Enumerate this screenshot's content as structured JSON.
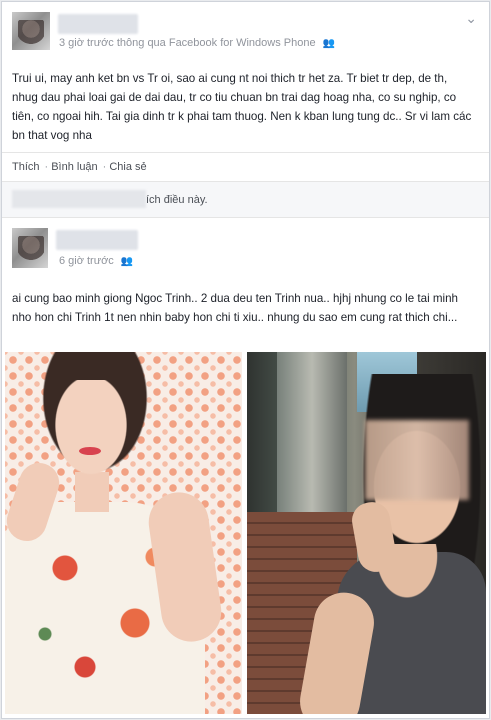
{
  "post1": {
    "meta": "3 giờ trước thông qua Facebook for Windows Phone",
    "friends_icon": "friends-icon",
    "text": "Trui ui, may anh ket bn vs Tr oi, sao ai cung nt noi thich tr het za. Tr biet tr dep, de th, nhug dau phai loai gai de dai dau, tr co tiu chuan bn trai dag hoag nha, co su nghip, co tiên, co ngoai hih. Tai gia dinh tr k phai tam thuog. Nen k kban lung tung dc.. Sr vi lam các bn that vog nha"
  },
  "actions": {
    "like": "Thích",
    "comment": "Bình luận",
    "share": "Chia sẻ",
    "sep": "·"
  },
  "likes": {
    "text": "ích điều này."
  },
  "post2": {
    "meta": "6 giờ trước",
    "friends_icon": "friends-icon",
    "text": "ai cung bao minh giong Ngoc Trinh.. 2 dua deu ten Trinh nua.. hjhj nhung co le tai minh nho hon chi Trinh 1t nen nhin baby hon chi ti xiu.. nhung du sao em cung rat thich chi..."
  },
  "menu_chevron": "chevron-down-icon"
}
